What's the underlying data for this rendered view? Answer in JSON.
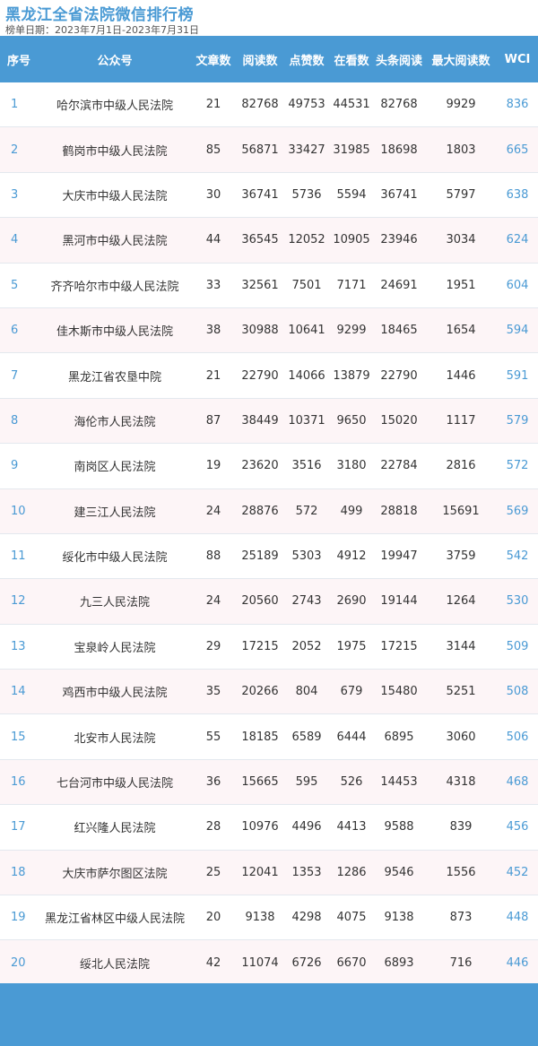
{
  "title": "黑龙江全省法院微信排行榜",
  "date_range": "榜单日期：2023年7月1日-2023年7月31日",
  "columns": [
    "序号",
    "公众号",
    "文章数",
    "阅读数",
    "点赞数",
    "在看数",
    "头条阅读",
    "最大阅读数",
    "WCI"
  ],
  "rows": [
    [
      "1",
      "哈尔滨市中级人民法院",
      "21",
      "82768",
      "49753",
      "44531",
      "82768",
      "9929",
      "836"
    ],
    [
      "2",
      "鹤岗市中级人民法院",
      "85",
      "56871",
      "33427",
      "31985",
      "18698",
      "1803",
      "665"
    ],
    [
      "3",
      "大庆市中级人民法院",
      "30",
      "36741",
      "5736",
      "5594",
      "36741",
      "5797",
      "638"
    ],
    [
      "4",
      "黑河市中级人民法院",
      "44",
      "36545",
      "12052",
      "10905",
      "23946",
      "3034",
      "624"
    ],
    [
      "5",
      "齐齐哈尔市中级人民法院",
      "33",
      "32561",
      "7501",
      "7171",
      "24691",
      "1951",
      "604"
    ],
    [
      "6",
      "佳木斯市中级人民法院",
      "38",
      "30988",
      "10641",
      "9299",
      "18465",
      "1654",
      "594"
    ],
    [
      "7",
      "黑龙江省农垦中院",
      "21",
      "22790",
      "14066",
      "13879",
      "22790",
      "1446",
      "591"
    ],
    [
      "8",
      "海伦市人民法院",
      "87",
      "38449",
      "10371",
      "9650",
      "15020",
      "1117",
      "579"
    ],
    [
      "9",
      "南岗区人民法院",
      "19",
      "23620",
      "3516",
      "3180",
      "22784",
      "2816",
      "572"
    ],
    [
      "10",
      "建三江人民法院",
      "24",
      "28876",
      "572",
      "499",
      "28818",
      "15691",
      "569"
    ],
    [
      "11",
      "绥化市中级人民法院",
      "88",
      "25189",
      "5303",
      "4912",
      "19947",
      "3759",
      "542"
    ],
    [
      "12",
      "九三人民法院",
      "24",
      "20560",
      "2743",
      "2690",
      "19144",
      "1264",
      "530"
    ],
    [
      "13",
      "宝泉岭人民法院",
      "29",
      "17215",
      "2052",
      "1975",
      "17215",
      "3144",
      "509"
    ],
    [
      "14",
      "鸡西市中级人民法院",
      "35",
      "20266",
      "804",
      "679",
      "15480",
      "5251",
      "508"
    ],
    [
      "15",
      "北安市人民法院",
      "55",
      "18185",
      "6589",
      "6444",
      "6895",
      "3060",
      "506"
    ],
    [
      "16",
      "七台河市中级人民法院",
      "36",
      "15665",
      "595",
      "526",
      "14453",
      "4318",
      "468"
    ],
    [
      "17",
      "红兴隆人民法院",
      "28",
      "10976",
      "4496",
      "4413",
      "9588",
      "839",
      "456"
    ],
    [
      "18",
      "大庆市萨尔图区法院",
      "25",
      "12041",
      "1353",
      "1286",
      "9546",
      "1556",
      "452"
    ],
    [
      "19",
      "黑龙江省林区中级人民法院",
      "20",
      "9138",
      "4298",
      "4075",
      "9138",
      "873",
      "448"
    ],
    [
      "20",
      "绥北人民法院",
      "42",
      "11074",
      "6726",
      "6670",
      "6893",
      "716",
      "446"
    ]
  ],
  "colors": {
    "accent": "#4a9ad4",
    "row_alt": "#fdf5f7",
    "row_base": "#ffffff"
  }
}
